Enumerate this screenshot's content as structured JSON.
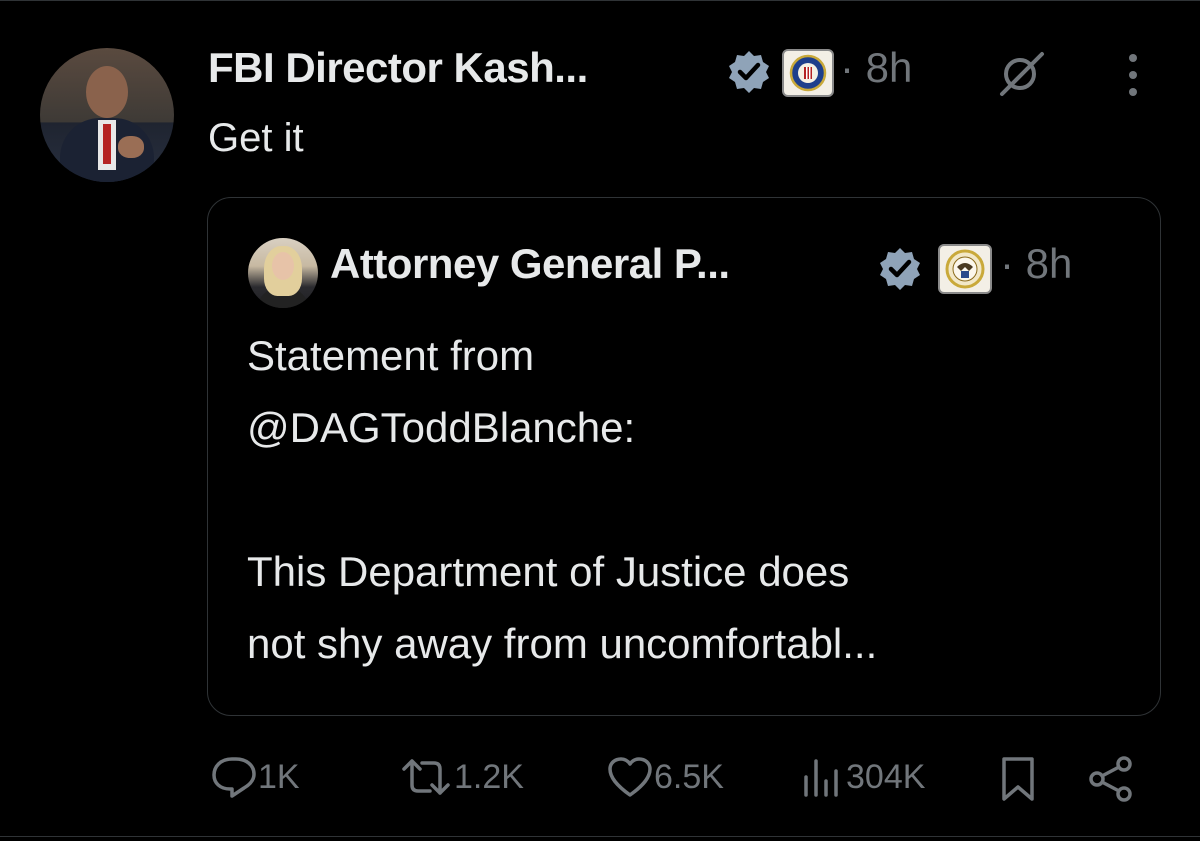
{
  "post": {
    "author_name": "FBI Director Kash...",
    "time": "· 8h",
    "text": "Get it"
  },
  "quoted_post": {
    "author_name": "Attorney General P...",
    "time": "· 8h",
    "text": "Statement from\n@DAGToddBlanche:\n\nThis Department of Justice does\nnot shy away from uncomfortabl..."
  },
  "actions": {
    "replies": "1K",
    "reposts": "1.2K",
    "likes": "6.5K",
    "views": "304K"
  },
  "icons": {
    "verified": "verified-badge-icon",
    "org": "affiliation-seal-icon",
    "grok": "grok-icon",
    "more": "more-options-icon",
    "reply": "reply-icon",
    "repost": "repost-icon",
    "like": "heart-icon",
    "views": "views-icon",
    "bookmark": "bookmark-icon",
    "share": "share-icon"
  },
  "colors": {
    "background": "#000000",
    "text": "#e7e9ea",
    "secondary": "#71767b",
    "verified_badge": "#8fa3b8",
    "border": "#2f3336"
  }
}
